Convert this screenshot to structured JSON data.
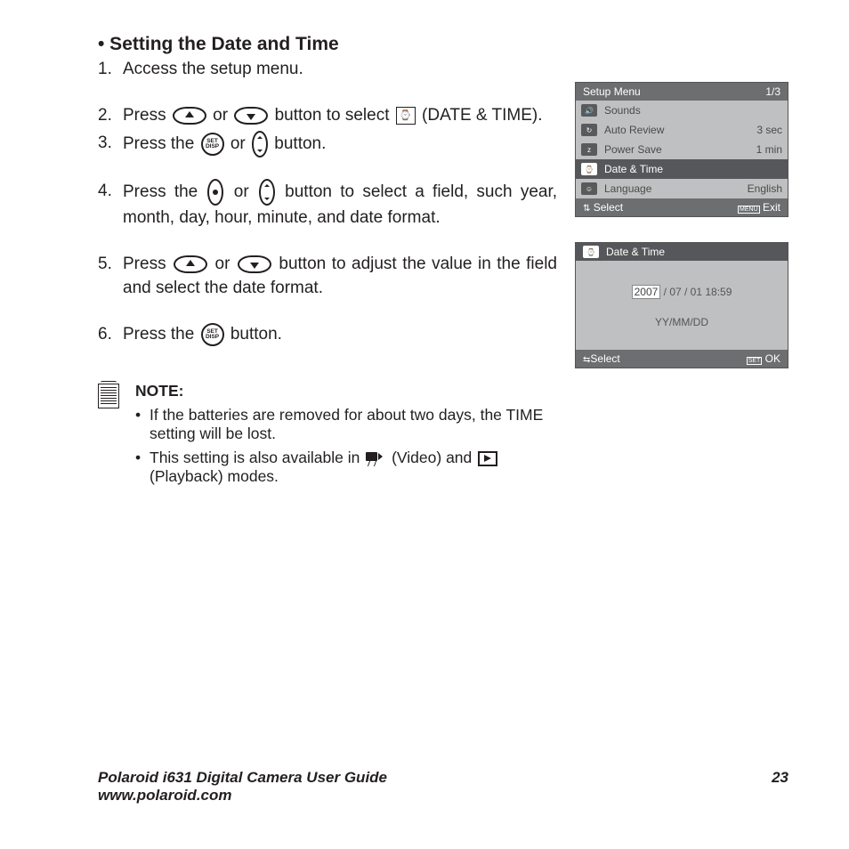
{
  "heading": "• Setting the Date and Time",
  "steps": {
    "s1_num": "1.",
    "s1_txt": "Access the setup menu.",
    "s2_num": "2.",
    "s2_pre": "Press ",
    "s2_mid": " or ",
    "s2_mid2": " button to select ",
    "s2_post": " (DATE & TIME).",
    "s3_num": "3.",
    "s3_pre": "Press the ",
    "s3_mid": " or ",
    "s3_post": " button.",
    "s4_num": "4.",
    "s4_pre": "Press the ",
    "s4_mid": " or ",
    "s4_post": " button to select a field, such year, month, day, hour, minute, and date format.",
    "s5_num": "5.",
    "s5_pre": "Press ",
    "s5_mid": " or ",
    "s5_post": " button to adjust the value in the field and select the date format.",
    "s6_num": "6.",
    "s6_pre": "Press  the ",
    "s6_post": " button."
  },
  "note": {
    "title": "NOTE:",
    "n1": "If the batteries are removed for about two days, the TIME setting will be lost.",
    "n2_pre": "This setting is also available in ",
    "n2_mid": " (Video) and ",
    "n2_post": " (Playback) modes."
  },
  "screen1": {
    "title": "Setup Menu",
    "page": "1/3",
    "r1": "Sounds",
    "r1v": "",
    "r2": "Auto Review",
    "r2v": "3 sec",
    "r3": "Power Save",
    "r3v": "1 min",
    "r4": "Date & Time",
    "r4v": "",
    "r5": "Language",
    "r5v": "English",
    "f1": "Select",
    "f2": "Exit",
    "menu_label": "MENU"
  },
  "screen2": {
    "title": "Date & Time",
    "year": "2007",
    "rest": " / 07 / 01   18:59",
    "fmt": "YY/MM/DD",
    "f1": "Select",
    "f2": "OK",
    "set_label": "SET"
  },
  "footer": {
    "title": "Polaroid i631 Digital Camera User Guide",
    "url": "www.polaroid.com",
    "page": "23"
  }
}
